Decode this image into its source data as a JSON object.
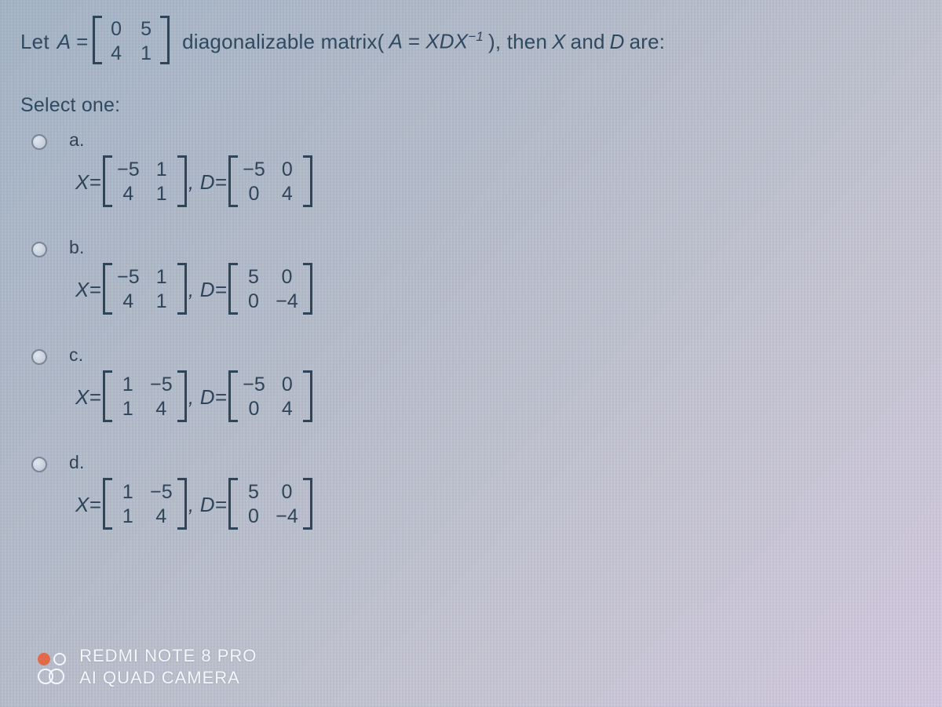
{
  "question": {
    "let": "Let",
    "A_eq": "A =",
    "A_matrix": [
      [
        "0",
        "5"
      ],
      [
        "4",
        "1"
      ]
    ],
    "diag_text_1": "diagonalizable matrix(",
    "diag_formula": "A = XDX",
    "diag_exp": "−1",
    "diag_text_2": "), then",
    "X_and": "X",
    "and_word": "and",
    "D_var": "D",
    "are": "are:"
  },
  "select_one": "Select one:",
  "options": [
    {
      "letter": "a.",
      "X": [
        [
          "−5",
          "1"
        ],
        [
          "4",
          "1"
        ]
      ],
      "D": [
        [
          "−5",
          "0"
        ],
        [
          "0",
          "4"
        ]
      ]
    },
    {
      "letter": "b.",
      "X": [
        [
          "−5",
          "1"
        ],
        [
          "4",
          "1"
        ]
      ],
      "D": [
        [
          "5",
          "0"
        ],
        [
          "0",
          "−4"
        ]
      ]
    },
    {
      "letter": "c.",
      "X": [
        [
          "1",
          "−5"
        ],
        [
          "1",
          "4"
        ]
      ],
      "D": [
        [
          "−5",
          "0"
        ],
        [
          "0",
          "4"
        ]
      ]
    },
    {
      "letter": "d.",
      "X": [
        [
          "1",
          "−5"
        ],
        [
          "1",
          "4"
        ]
      ],
      "D": [
        [
          "5",
          "0"
        ],
        [
          "0",
          "−4"
        ]
      ]
    }
  ],
  "eq_labels": {
    "Xeq": "X=",
    "Deq": ", D=",
    "Deq2": "D="
  },
  "watermark": {
    "line1": "REDMI NOTE 8 PRO",
    "line2": "AI QUAD CAMERA"
  }
}
